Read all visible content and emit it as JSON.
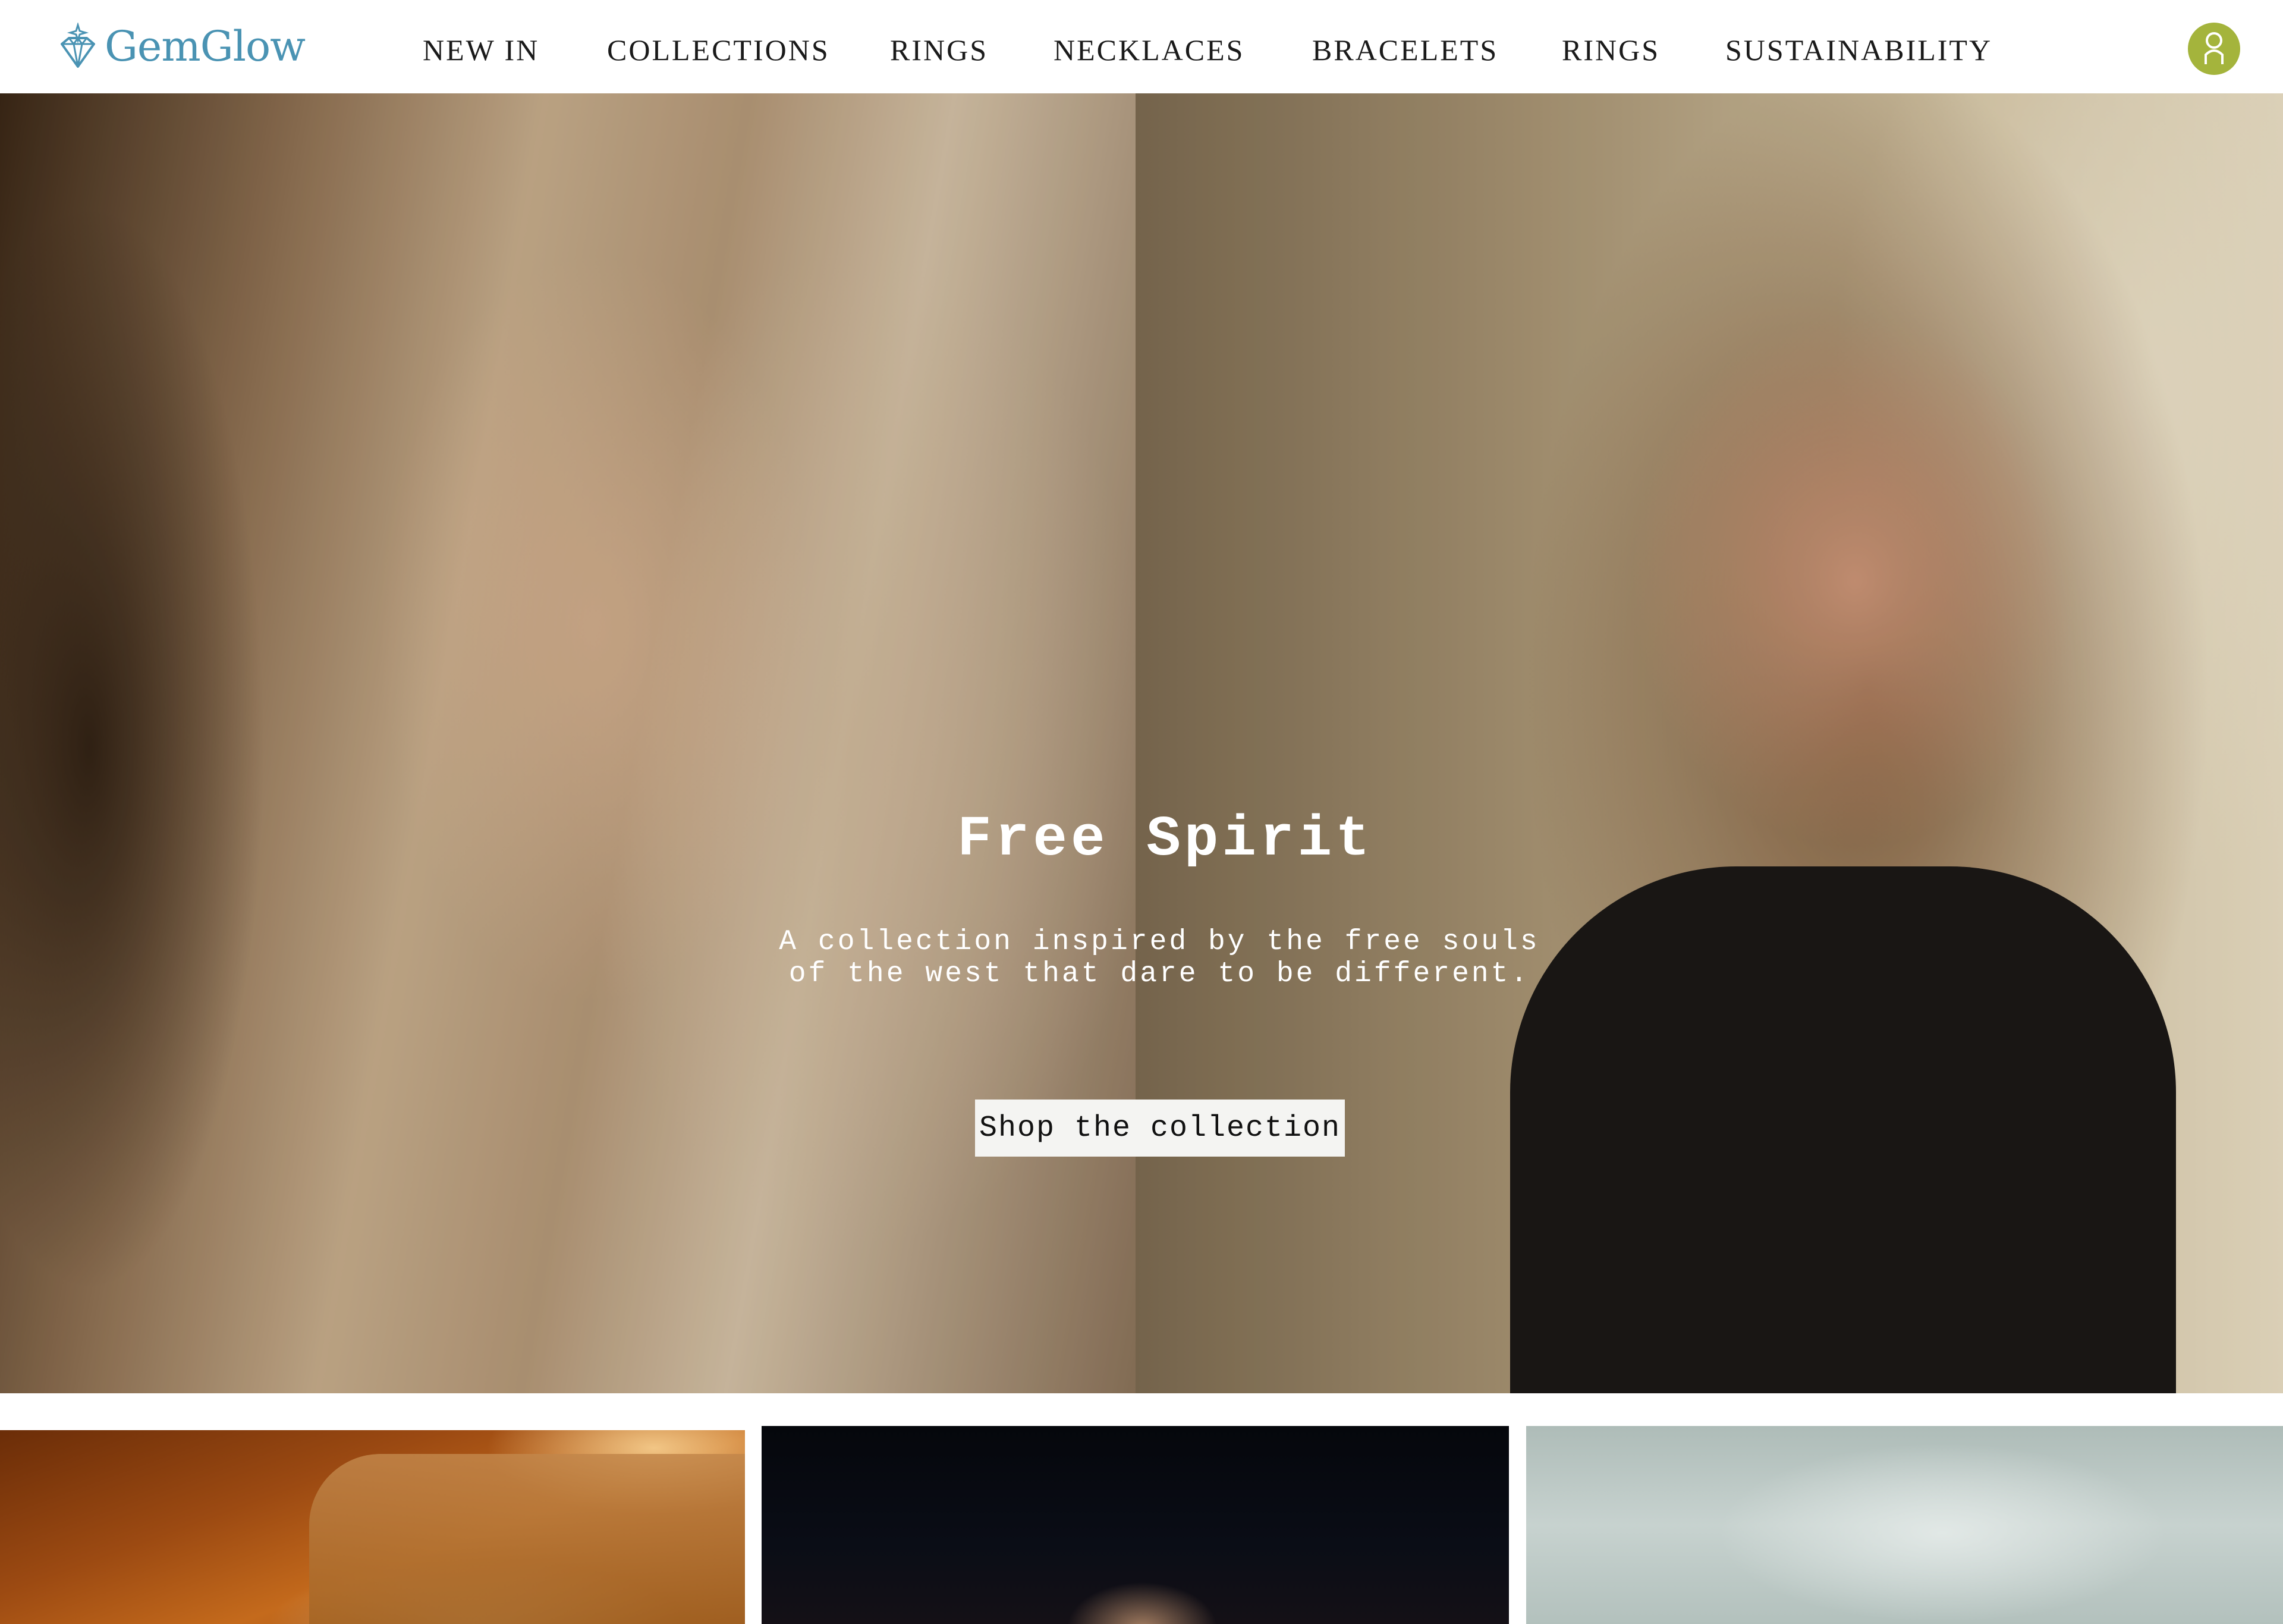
{
  "brand": {
    "name": "GemGlow",
    "logo_icon": "diamond-sparkle-icon",
    "color": "#4a93b3"
  },
  "nav": {
    "items": [
      {
        "label": "NEW IN"
      },
      {
        "label": "COLLECTIONS"
      },
      {
        "label": "RINGS"
      },
      {
        "label": "NECKLACES"
      },
      {
        "label": "BRACELETS"
      },
      {
        "label": "RINGS"
      },
      {
        "label": "SUSTAINABILITY"
      }
    ],
    "text_color": "#1a1a1a"
  },
  "account": {
    "icon": "user-icon",
    "color": "#a4b43c"
  },
  "hero": {
    "title": "Free Spirit",
    "subtitle": "A collection inspired by the free souls\nof the west that dare to be different.",
    "cta_label": "Shop the collection"
  },
  "tiles": [
    {
      "image": "warm-interior-jewelry-photo"
    },
    {
      "image": "dark-portrait-photo"
    },
    {
      "image": "pale-sky-photo"
    }
  ]
}
